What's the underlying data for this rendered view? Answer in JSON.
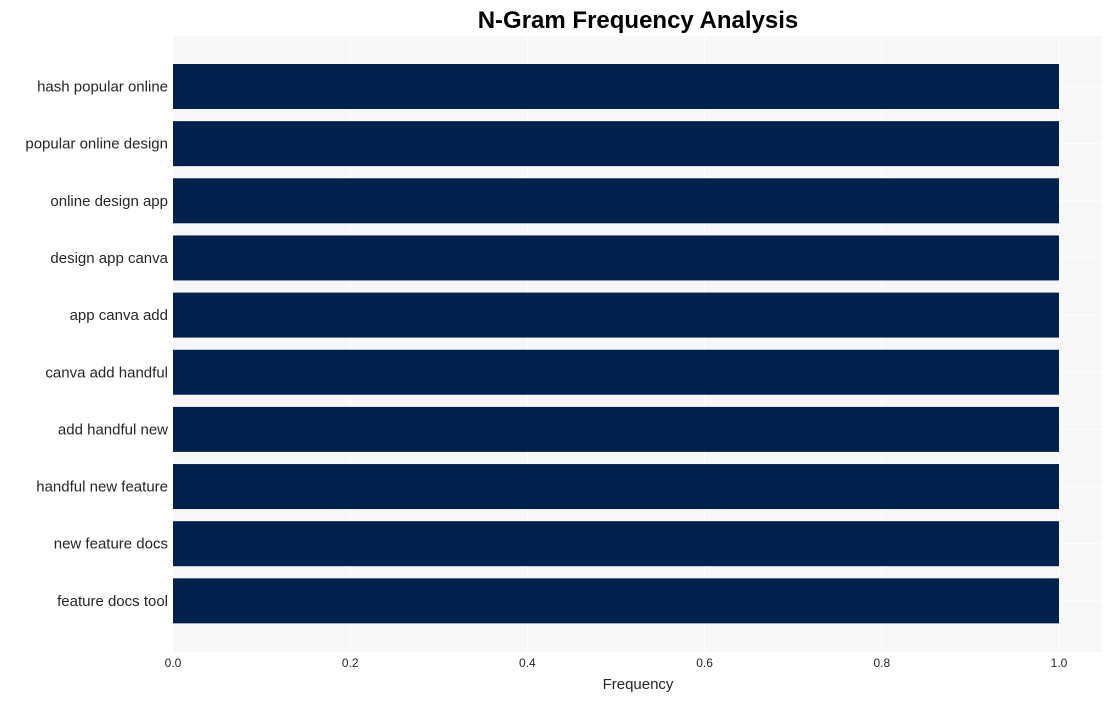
{
  "chart_data": {
    "type": "bar",
    "orientation": "horizontal",
    "title": "N-Gram Frequency Analysis",
    "xlabel": "Frequency",
    "ylabel": "",
    "categories": [
      "hash popular online",
      "popular online design",
      "online design app",
      "design app canva",
      "app canva add",
      "canva add handful",
      "add handful new",
      "handful new feature",
      "new feature docs",
      "feature docs tool"
    ],
    "values": [
      1,
      1,
      1,
      1,
      1,
      1,
      1,
      1,
      1,
      1
    ],
    "xlim": [
      0,
      1.05
    ],
    "xticks": [
      0.0,
      0.2,
      0.4,
      0.6,
      0.8,
      1.0
    ],
    "xtick_labels": [
      "0.0",
      "0.2",
      "0.4",
      "0.6",
      "0.8",
      "1.0"
    ],
    "grid": true,
    "legend": "none",
    "colors": {
      "bar": "#00204e",
      "plot_background": "#f7f7f7",
      "grid": "#ffffff"
    }
  }
}
